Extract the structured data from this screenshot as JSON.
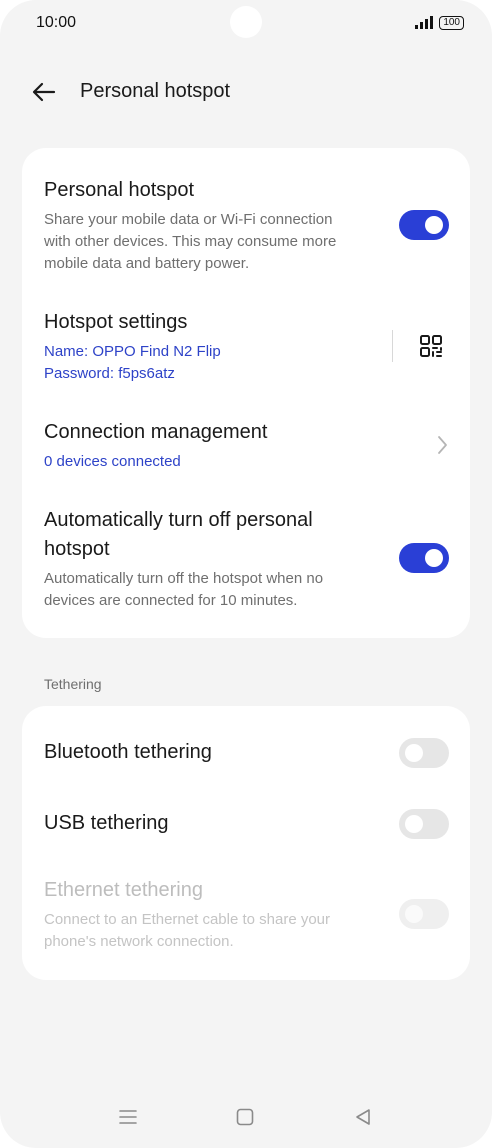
{
  "status_bar": {
    "time": "10:00",
    "battery": "100"
  },
  "header": {
    "title": "Personal hotspot",
    "back_icon": "arrow-left-icon"
  },
  "hotspot_card": {
    "personal_hotspot": {
      "title": "Personal hotspot",
      "description_line1": "Share your mobile data or Wi-Fi connection",
      "description_line2": "with other devices. This may consume more",
      "description_line3": "mobile data and battery power.",
      "enabled": true
    },
    "hotspot_settings": {
      "title": "Hotspot settings",
      "name_line": "Name: OPPO Find N2 Flip",
      "password_line": "Password: f5ps6atz",
      "qr_icon": "qr-code-icon"
    },
    "connection_management": {
      "title": "Connection management",
      "subtitle": "0 devices connected",
      "chevron_icon": "chevron-right-icon"
    },
    "auto_turn_off": {
      "title_line1": "Automatically turn off personal",
      "title_line2": "hotspot",
      "description_line1": "Automatically turn off the hotspot when no",
      "description_line2": "devices are connected for 10 minutes.",
      "enabled": true
    }
  },
  "tethering_section": {
    "label": "Tethering",
    "bluetooth": {
      "title": "Bluetooth tethering",
      "enabled": false
    },
    "usb": {
      "title": "USB tethering",
      "enabled": false
    },
    "ethernet": {
      "title": "Ethernet tethering",
      "description_line1": "Connect to an Ethernet cable to share your",
      "description_line2": "phone's network connection.",
      "enabled": false,
      "disabled": true
    }
  },
  "nav_bar": {
    "menu_icon": "menu-icon",
    "home_icon": "home-square-icon",
    "back_icon": "back-triangle-icon"
  },
  "colors": {
    "accent": "#2a3fd6",
    "link": "#2e43c8",
    "background": "#f4f4f4",
    "card": "#ffffff"
  }
}
